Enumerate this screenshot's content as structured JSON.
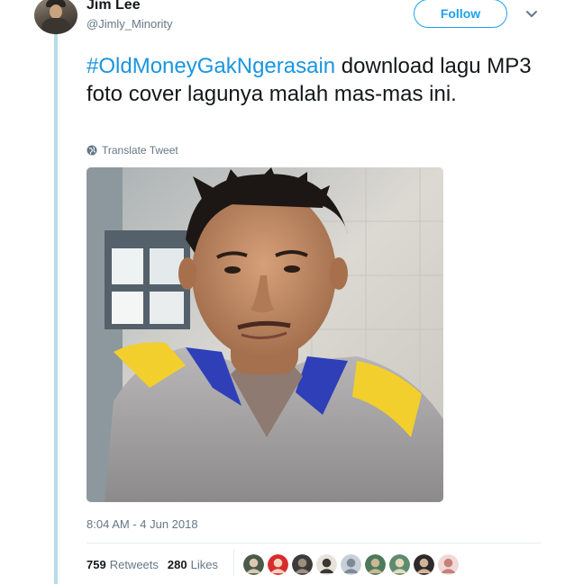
{
  "author": {
    "name": "Jim Lee",
    "handle": "@Jimly_Minority"
  },
  "follow_label": "Follow",
  "tweet": {
    "hashtag": "#OldMoneyGakNgerasain",
    "text": " download lagu MP3 foto cover lagunya malah mas-mas ini."
  },
  "translate_label": "Translate Tweet",
  "timestamp": "8:04 AM - 4 Jun 2018",
  "stats": {
    "retweets_count": "759",
    "retweets_label": "Retweets",
    "likes_count": "280",
    "likes_label": "Likes"
  },
  "colors": {
    "accent": "#1da1f2",
    "hashtag": "#1b95e0",
    "muted": "#657786",
    "thread_line": "#b8dcea"
  },
  "icons": {
    "caret": "chevron-down-icon",
    "translate": "globe-icon"
  },
  "liker_avatars": [
    {
      "bg": "#4a5a48",
      "fg": "#d8c9b0"
    },
    {
      "bg": "#d92b2b",
      "fg": "#f3d2c0"
    },
    {
      "bg": "#3d3b3a",
      "fg": "#9c8f80"
    },
    {
      "bg": "#e8e2da",
      "fg": "#3b3633"
    },
    {
      "bg": "#c7d0d8",
      "fg": "#7d8a96"
    },
    {
      "bg": "#4c7a5a",
      "fg": "#c9b795"
    },
    {
      "bg": "#5e8c6e",
      "fg": "#e6d8bc"
    },
    {
      "bg": "#2c2a2c",
      "fg": "#d2b496"
    },
    {
      "bg": "#f2d8d6",
      "fg": "#c4817a"
    }
  ]
}
